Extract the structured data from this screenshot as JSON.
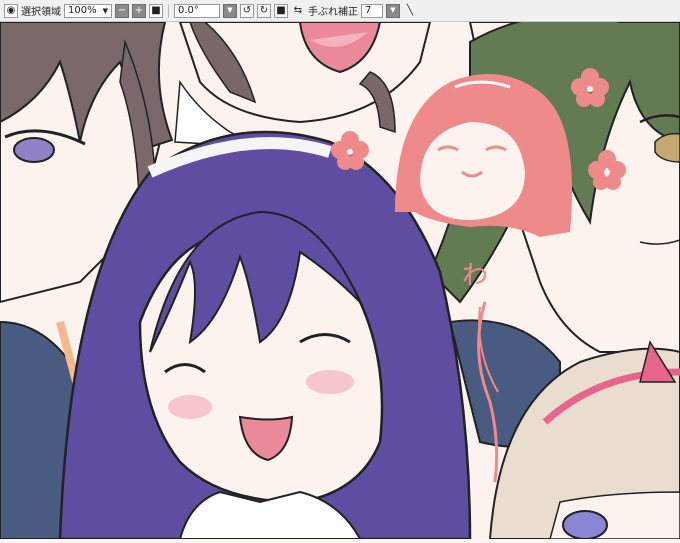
{
  "toolbar": {
    "selection_label": "選択領域",
    "zoom_value": "100%",
    "rotation_value": "0.0°",
    "stabilizer_label": "手ぶれ補正",
    "stabilizer_value": "7"
  },
  "canvas": {
    "sketch_text": "わ"
  },
  "colors": {
    "sketch": "#ef8a8a",
    "purple_hair": "#5e4da0",
    "green_hair": "#627b52",
    "brown_hair": "#7b6868",
    "blonde_hair": "#e9ddcf",
    "jacket": "#4a5b82"
  }
}
